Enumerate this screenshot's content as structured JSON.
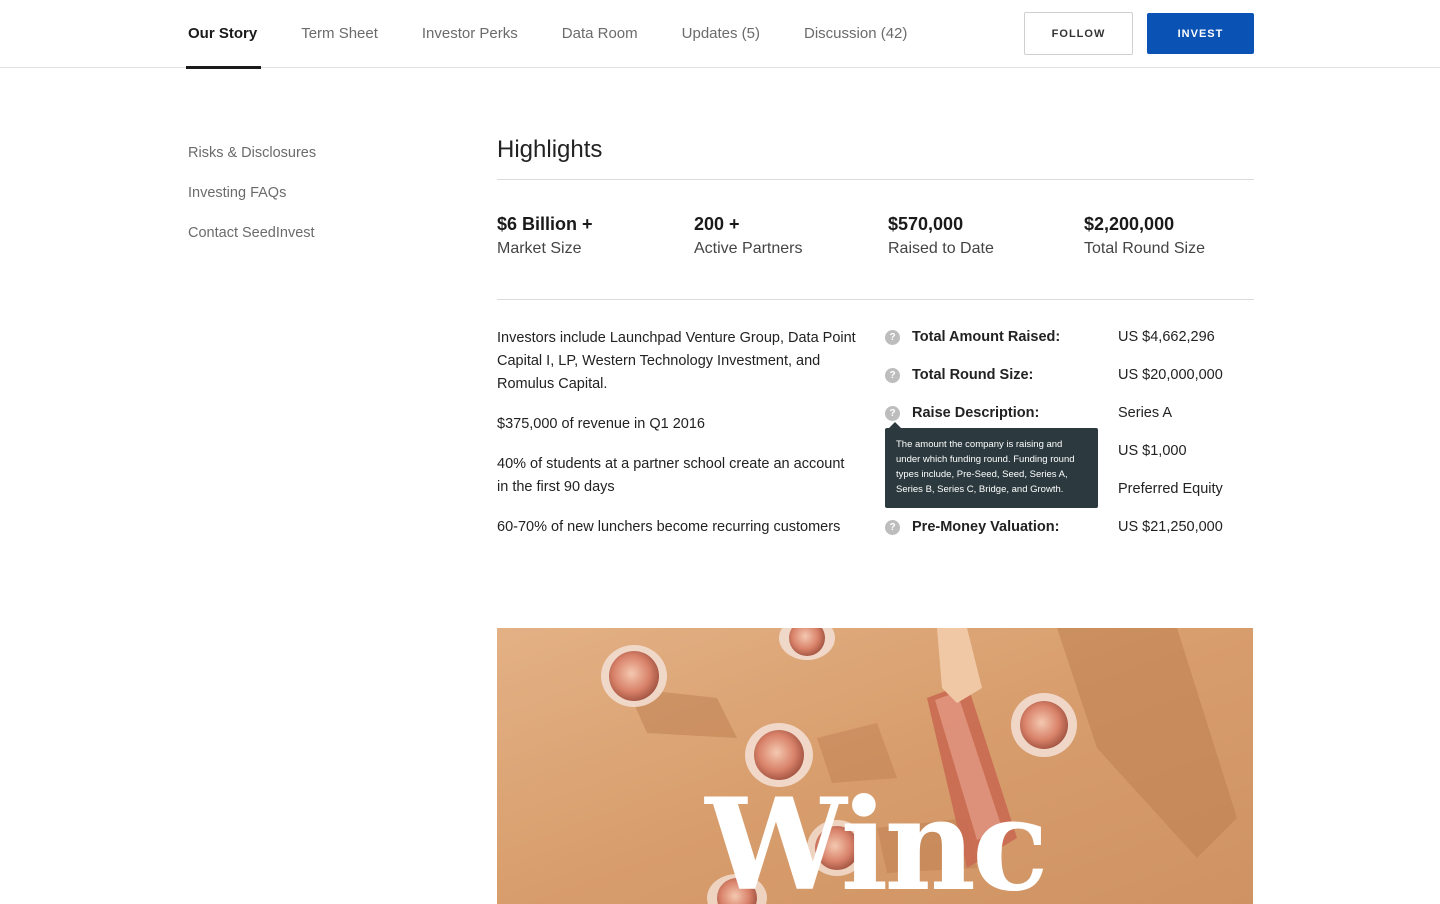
{
  "nav": {
    "tabs": [
      {
        "label": "Our Story",
        "active": true
      },
      {
        "label": "Term Sheet",
        "active": false
      },
      {
        "label": "Investor Perks",
        "active": false
      },
      {
        "label": "Data Room",
        "active": false
      },
      {
        "label": "Updates (5)",
        "active": false
      },
      {
        "label": "Discussion (42)",
        "active": false
      }
    ],
    "follow_label": "FOLLOW",
    "invest_label": "INVEST"
  },
  "sidebar": {
    "links": [
      "Risks & Disclosures",
      "Investing FAQs",
      "Contact SeedInvest"
    ]
  },
  "highlights": {
    "title": "Highlights",
    "stats": [
      {
        "value": "$6 Billion +",
        "label": "Market Size"
      },
      {
        "value": "200 +",
        "label": "Active Partners"
      },
      {
        "value": "$570,000",
        "label": "Raised to Date"
      },
      {
        "value": "$2,200,000",
        "label": "Total Round Size"
      }
    ],
    "bullets": [
      "Investors include Launchpad Venture Group, Data Point Capital I, LP, Western Technology Investment, and Romulus Capital.",
      "$375,000 of revenue in Q1 2016",
      "40% of students at a partner school create an account in the first 90 days",
      "60-70% of new lunchers become recurring customers"
    ],
    "terms": [
      {
        "label": "Total Amount Raised:",
        "value": "US $4,662,296"
      },
      {
        "label": "Total Round Size:",
        "value": "US $20,000,000"
      },
      {
        "label": "Raise Description:",
        "value": "Series A"
      },
      {
        "label": "",
        "value": "US $1,000"
      },
      {
        "label": "",
        "value": "Preferred Equity"
      },
      {
        "label": "Pre-Money Valuation:",
        "value": "US $21,250,000"
      }
    ],
    "tooltip": "The amount the company is raising and under which funding round. Funding round types include, Pre-Seed, Seed, Series A, Series B, Series C, Bridge, and Growth."
  },
  "hero": {
    "logo_text": "Winc"
  },
  "colors": {
    "accent": "#0a52b4",
    "tooltip_bg": "#2c3a3f",
    "hero_bg": "#dba57a"
  }
}
